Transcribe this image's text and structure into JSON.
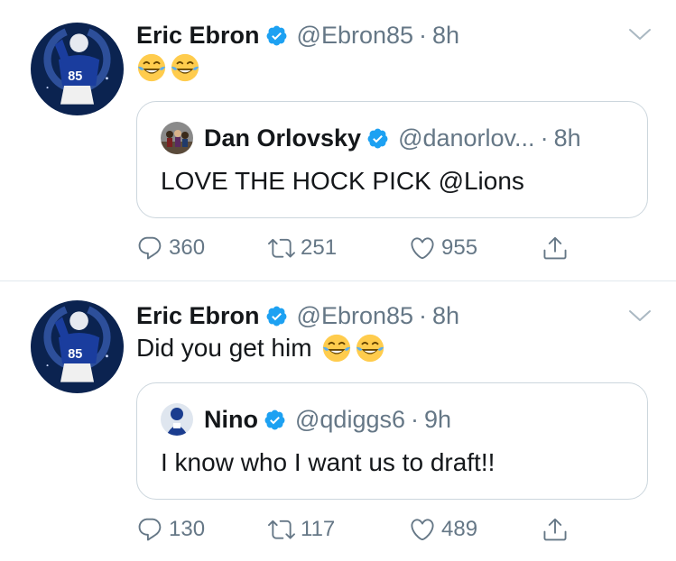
{
  "tweets": [
    {
      "author": {
        "name": "Eric Ebron",
        "handle": "@Ebron85",
        "time": "8h",
        "avatar": "colts-player-85-avatar"
      },
      "text": "",
      "emojis": [
        "face-with-tears-of-joy",
        "face-with-tears-of-joy"
      ],
      "quote": {
        "author": {
          "name": "Dan Orlovsky",
          "handle": "@danorlov...",
          "time": "8h"
        },
        "text": "LOVE THE HOCK PICK @Lions"
      },
      "stats": {
        "replies": "360",
        "retweets": "251",
        "likes": "955"
      }
    },
    {
      "author": {
        "name": "Eric Ebron",
        "handle": "@Ebron85",
        "time": "8h",
        "avatar": "colts-player-85-avatar"
      },
      "text": "Did you get him",
      "emojis": [
        "face-with-tears-of-joy",
        "face-with-tears-of-joy"
      ],
      "quote": {
        "author": {
          "name": "Nino",
          "handle": "@qdiggs6",
          "time": "9h"
        },
        "text": "I know who I want us to draft!!"
      },
      "stats": {
        "replies": "130",
        "retweets": "117",
        "likes": "489"
      }
    }
  ],
  "separator": "·",
  "colors": {
    "verified": "#1da1f2",
    "muted": "#657786",
    "text": "#14171a",
    "border": "#ccd6dd",
    "colts_blue": "#0b2a6b"
  }
}
